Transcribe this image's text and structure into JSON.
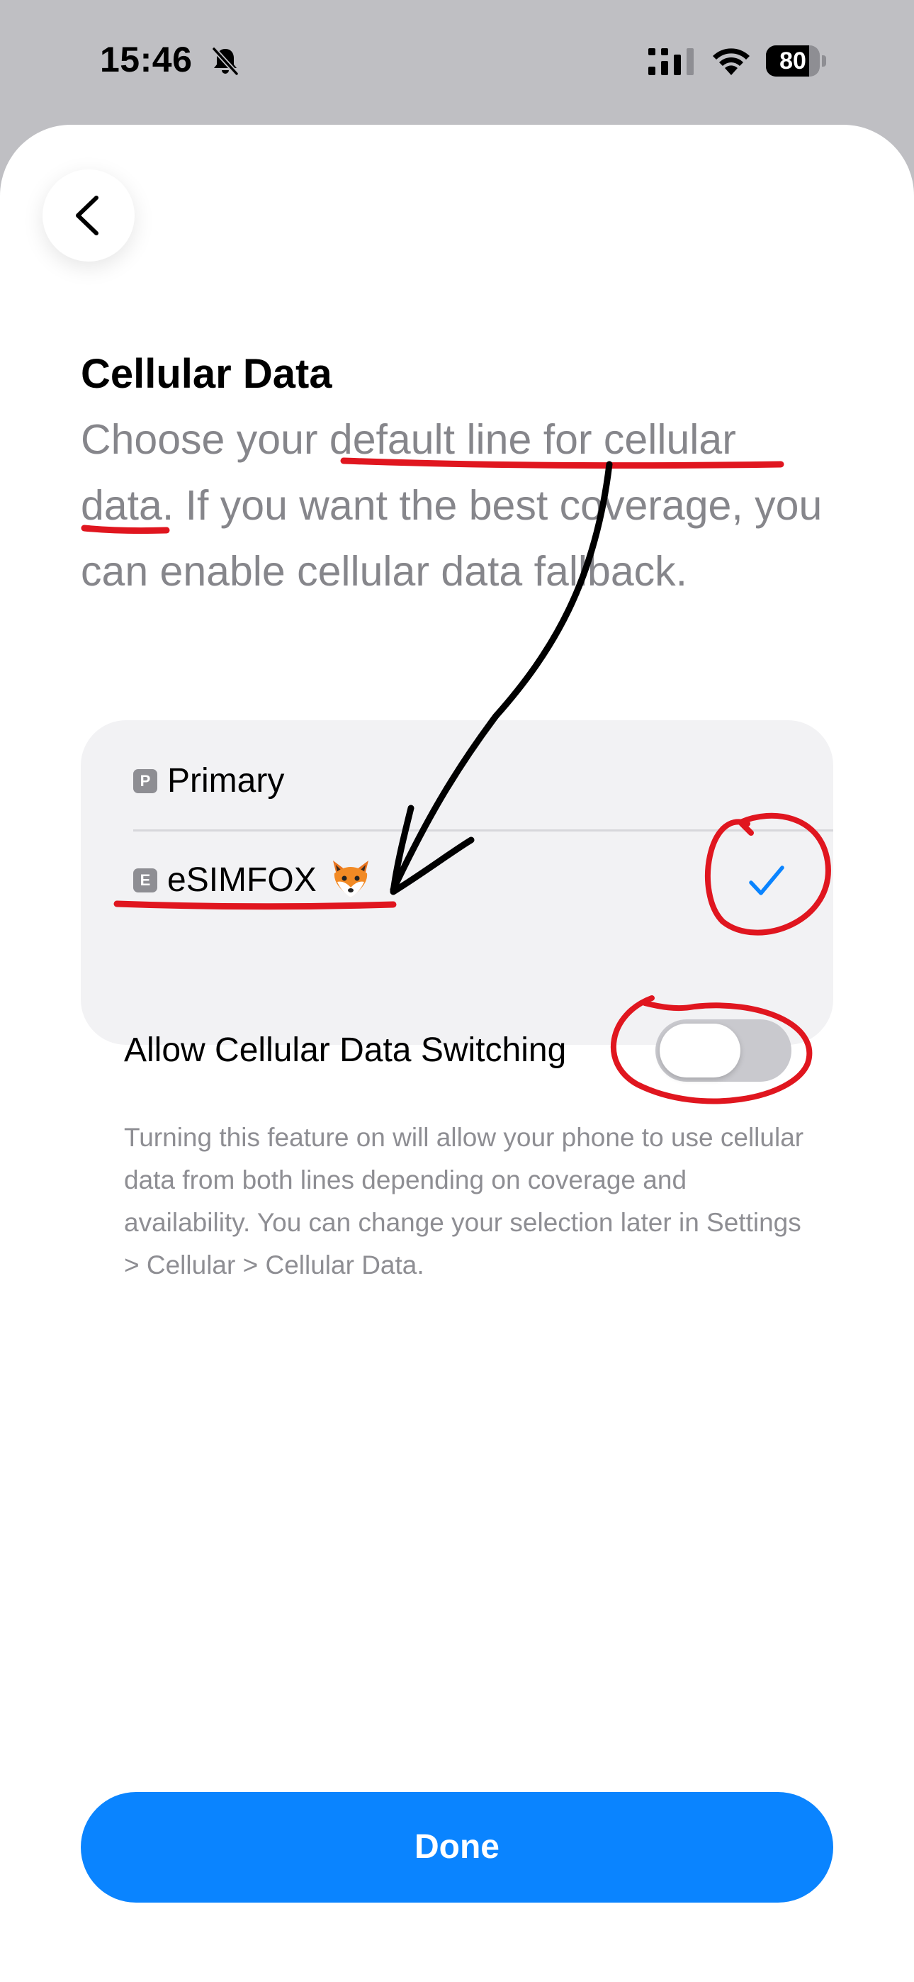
{
  "status_bar": {
    "time": "15:46",
    "battery_percent": "80",
    "battery_level": 0.8
  },
  "screen": {
    "title": "Cellular Data",
    "description": "Choose your default line for cellular data. If you want the best coverage, you can enable cellular data fallback."
  },
  "lines": [
    {
      "badge": "P",
      "label": "Primary",
      "selected": false
    },
    {
      "badge": "E",
      "label": "eSIMFOX",
      "selected": true
    }
  ],
  "data_switching": {
    "label": "Allow Cellular Data Switching",
    "enabled": false,
    "footnote": "Turning this feature on will allow your phone to use cellular data from both lines depending on coverage and availability. You can change your selection later in Settings > Cellular > Cellular Data."
  },
  "done_button": {
    "label": "Done"
  },
  "icons": {
    "back": "chevron-left-icon",
    "bell": "bell-slash-icon",
    "signal": "cellular-signal-icon",
    "wifi": "wifi-icon",
    "battery": "battery-icon",
    "check": "checkmark-icon",
    "fox": "fox-emoji-icon"
  },
  "colors": {
    "accent": "#0a84ff",
    "annotation_red": "#e0161f",
    "annotation_black": "#000000",
    "secondary_text": "#86868b"
  }
}
